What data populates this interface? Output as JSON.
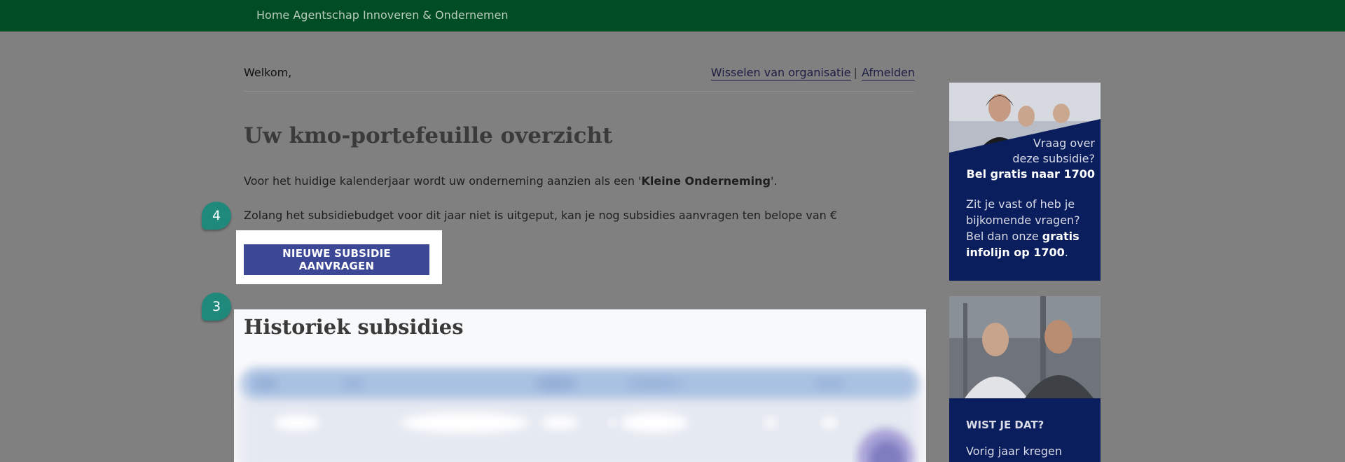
{
  "topbar": {
    "home_link": "Home Agentschap Innoveren & Ondernemen"
  },
  "header": {
    "welcome": "Welkom,",
    "switch_org": "Wisselen van organisatie",
    "separator": "|",
    "logout": "Afmelden"
  },
  "main": {
    "title": "Uw kmo-portefeuille overzicht",
    "intro_prefix": "Voor het huidige kalenderjaar wordt uw onderneming aanzien als een '",
    "intro_bold": "Kleine Onderneming",
    "intro_suffix": "'.",
    "budget_text": "Zolang het subsidiebudget voor dit jaar niet is uitgeput, kan je nog subsidies aanvragen ten belope van €",
    "new_button": "NIEUWE SUBSIDIE AANVRAGEN",
    "history_title": "Historiek subsidies"
  },
  "badges": {
    "step4": "4",
    "step3": "3"
  },
  "sidebar": {
    "ad1": {
      "q_line1": "Vraag over",
      "q_line2": "deze subsidie?",
      "q_line3": "Bel gratis naar 1700",
      "b_line1": "Zit je vast of heb je",
      "b_line2": "bijkomende vragen?",
      "b_line3_prefix": "Bel dan onze ",
      "b_line3_bold": "gratis",
      "b_line4_bold": "infolijn op 1700",
      "b_line4_suffix": "."
    },
    "ad2": {
      "heading": "WIST JE DAT?",
      "text": "Vorig jaar kregen"
    }
  },
  "colors": {
    "topbar": "#004c24",
    "overlay": "#808080",
    "button": "#3c4796",
    "badge": "#1f8a7c",
    "sidebar_bg": "#0a1e5e"
  }
}
